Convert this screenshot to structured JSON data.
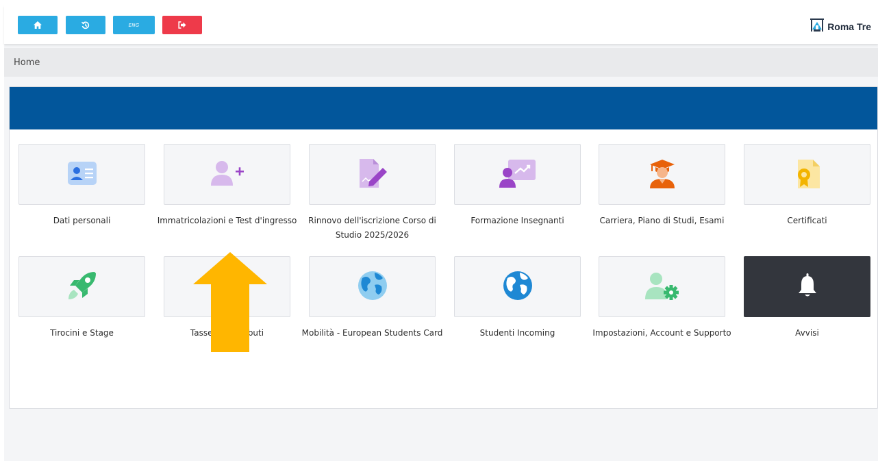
{
  "topbar": {
    "buttons": [
      {
        "name": "home",
        "icon": "home-icon",
        "color": "#2aabe2"
      },
      {
        "name": "history",
        "icon": "history-icon",
        "color": "#2aabe2"
      },
      {
        "name": "language",
        "label": "ENG",
        "color": "#2aabe2"
      },
      {
        "name": "logout",
        "icon": "logout-icon",
        "color": "#ee3a4a"
      }
    ],
    "logo_text": "Roma Tre"
  },
  "breadcrumb": {
    "home": "Home"
  },
  "colors": {
    "header_band": "#02569b",
    "accent_blue": "#2aabe2",
    "logout_red": "#ee3a4a",
    "arrow": "#ffb600"
  },
  "tiles": [
    {
      "label": "Dati personali",
      "icon": "id-card-icon"
    },
    {
      "label": "Immatricolazioni e Test d'ingresso",
      "icon": "add-user-icon"
    },
    {
      "label": "Rinnovo dell'iscrizione Corso di Studio 2025/2026",
      "icon": "document-edit-icon"
    },
    {
      "label": "Formazione Insegnanti",
      "icon": "teacher-presentation-icon"
    },
    {
      "label": "Carriera, Piano di Studi, Esami",
      "icon": "graduate-icon"
    },
    {
      "label": "Certificati",
      "icon": "certificate-icon"
    },
    {
      "label": "Tirocini e Stage",
      "icon": "rocket-icon"
    },
    {
      "label": "Tasse e Contributi",
      "icon": "money-icon"
    },
    {
      "label": "Mobilità - European Students Card",
      "icon": "globe-icon"
    },
    {
      "label": "Studenti Incoming",
      "icon": "globe-icon"
    },
    {
      "label": "Impostazioni, Account e Supporto",
      "icon": "user-settings-icon"
    },
    {
      "label": "Avvisi",
      "icon": "bell-icon"
    }
  ]
}
